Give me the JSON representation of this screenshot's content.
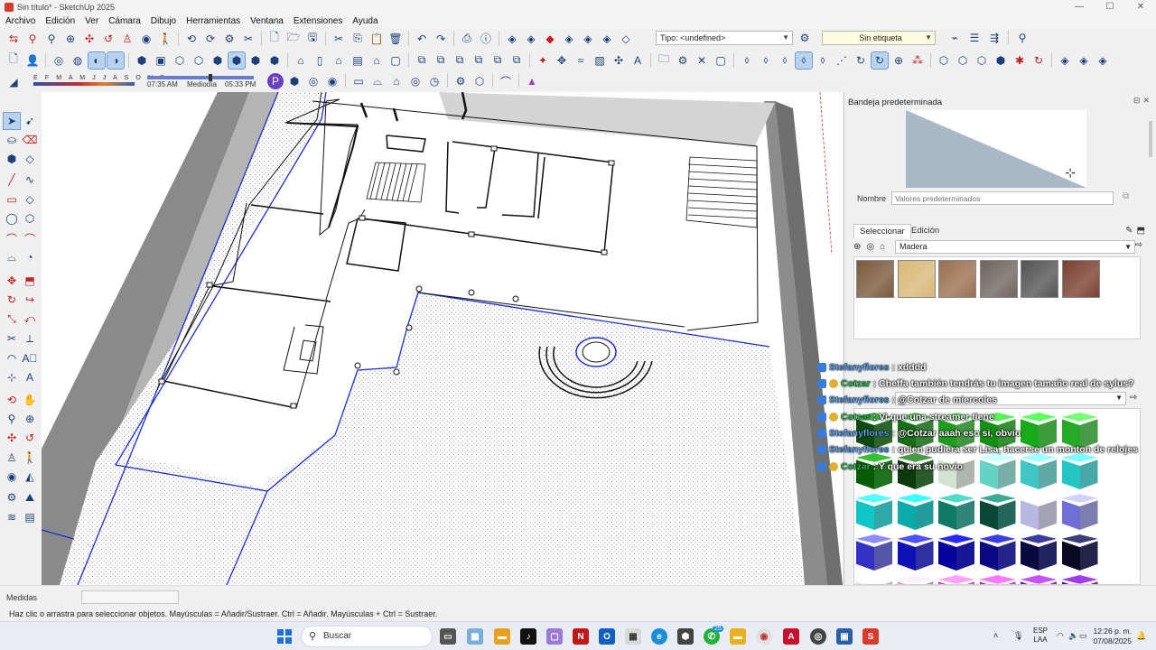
{
  "window": {
    "title": "Sin título* - SketchUp 2025",
    "buttons": [
      "—",
      "☐",
      "✕"
    ]
  },
  "menu": [
    "Archivo",
    "Edición",
    "Ver",
    "Cámara",
    "Dibujo",
    "Herramientas",
    "Ventana",
    "Extensiones",
    "Ayuda"
  ],
  "toolbar": {
    "tipo_label": "Tipo: <undefined>",
    "etiqueta_label": "Sin etiqueta"
  },
  "shadows": {
    "months": "E F M A M J J A S O N D",
    "time_start": "07:35 AM",
    "time_mid": "Mediodía",
    "time_end": "05:33 PM"
  },
  "tray": {
    "title": "Bandeja predeterminada",
    "name_label": "Nombre",
    "name_placeholder": "Valores predeterminados",
    "tab_select": "Seleccionar",
    "tab_edit": "Edición",
    "library": "Madera",
    "wood_swatches": [
      "#7a5a3c",
      "#d8b878",
      "#9a7050",
      "#6f6560",
      "#545454",
      "#7a4030"
    ]
  },
  "chat": [
    {
      "user": "Stefanyflores",
      "msg": ": xdddd",
      "badge": "blue"
    },
    {
      "user": "Cotzar",
      "msg": ": Cheffa también tendrás tu imagen tamaño real de sylus?",
      "badge": "gold"
    },
    {
      "user": "Stefanyflores",
      "msg": ": @Cotzar de miercoles",
      "badge": "blue"
    },
    {
      "user": "Cotzar",
      "msg": ": Vi que una streamer tiene",
      "badge": "gold"
    },
    {
      "user": "Stefanyflores",
      "msg": ": @Cotzar aaah eso si, obvio",
      "badge": "blue"
    },
    {
      "user": "Stefanyflores",
      "msg": ": quien pudiera ser Lisa, hacerse un monton de relojes",
      "badge": "blue"
    },
    {
      "user": "Cotzar",
      "msg": ": Y que era su novio",
      "badge": "gold"
    }
  ],
  "status": {
    "medidas_label": "Medidas",
    "hint": "Haz clic o arrastra para seleccionar objetos. Mayúsculas = Añadir/Sustraer. Ctrl = Añadir. Mayúsculas + Ctrl = Sustraer."
  },
  "taskbar": {
    "search": "Buscar",
    "lang_top": "ESP",
    "lang_bottom": "LAA",
    "time": "12:26 p. m.",
    "date": "07/08/2025",
    "whatsapp_badge": "25"
  }
}
